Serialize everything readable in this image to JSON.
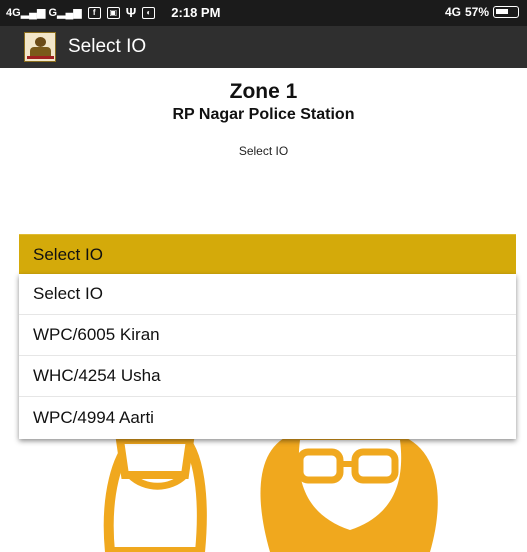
{
  "status_bar": {
    "signal_left": "4G",
    "signal_right": "G",
    "time": "2:18 PM",
    "network": "4G",
    "battery": "57%",
    "icons": [
      "facebook-icon",
      "image-icon",
      "usb-icon",
      "notification-icon"
    ]
  },
  "toolbar": {
    "title": "Select IO",
    "logo_icon": "police-logo-icon"
  },
  "header": {
    "zone": "Zone 1",
    "station": "RP Nagar Police Station",
    "label": "Select IO"
  },
  "spinner": {
    "selected": "Select IO",
    "accent_color": "#d4aa0a"
  },
  "dropdown": {
    "options": [
      "Select IO",
      "WPC/6005 Kiran",
      "WHC/4254 Usha",
      "WPC/4994 Aarti"
    ]
  },
  "colors": {
    "toolbar_bg": "#2f2f2f",
    "status_bg": "#1b1b1b",
    "illustration_fill": "#f0a81e"
  }
}
